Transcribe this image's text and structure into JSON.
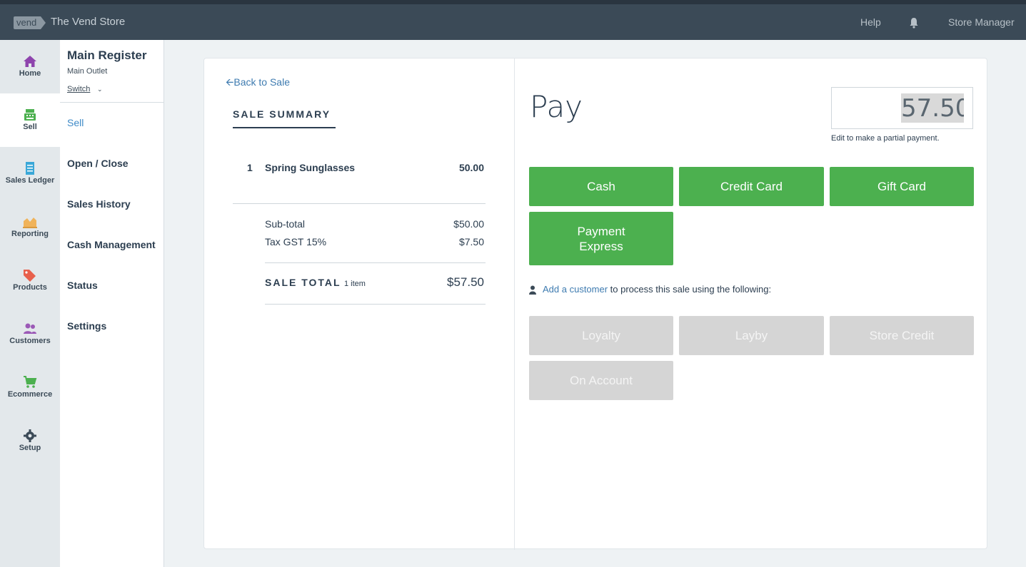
{
  "topbar": {
    "logo": "vend",
    "store_name": "The Vend Store",
    "help": "Help",
    "bell_icon": "bell-icon",
    "user": "Store Manager"
  },
  "nav": {
    "items": [
      {
        "label": "Home",
        "icon": "home-icon",
        "color": "#8e44ad"
      },
      {
        "label": "Sell",
        "icon": "register-icon",
        "color": "#4cb04f",
        "active": true
      },
      {
        "label": "Sales Ledger",
        "icon": "ledger-icon",
        "color": "#3ba8d8"
      },
      {
        "label": "Reporting",
        "icon": "chart-icon",
        "color": "#f0b35a"
      },
      {
        "label": "Products",
        "icon": "tags-icon",
        "color": "#e8604c"
      },
      {
        "label": "Customers",
        "icon": "users-icon",
        "color": "#9b59b6"
      },
      {
        "label": "Ecommerce",
        "icon": "cart-icon",
        "color": "#4cb04f"
      },
      {
        "label": "Setup",
        "icon": "gear-icon",
        "color": "#3b4a57"
      }
    ]
  },
  "register": {
    "title": "Main Register",
    "outlet": "Main Outlet",
    "switch": "Switch",
    "menu": [
      "Sell",
      "Open / Close",
      "Sales History",
      "Cash Management",
      "Status",
      "Settings"
    ]
  },
  "sale": {
    "back": "Back to Sale",
    "summary_title": "SALE SUMMARY",
    "line_item": {
      "qty": "1",
      "name": "Spring Sunglasses",
      "price": "50.00"
    },
    "subtotal_label": "Sub-total",
    "subtotal_value": "$50.00",
    "tax_label": "Tax GST 15%",
    "tax_value": "$7.50",
    "total_label": "SALE TOTAL",
    "total_items": "1 item",
    "total_value": "$57.50"
  },
  "pay": {
    "title": "Pay",
    "amount": "57.50",
    "hint": "Edit to make a partial payment.",
    "methods": [
      "Cash",
      "Credit Card",
      "Gift Card"
    ],
    "method4": [
      "Payment",
      "Express"
    ],
    "customer_link": "Add a customer",
    "customer_text": " to process this sale using the following:",
    "customer_methods": [
      "Loyalty",
      "Layby",
      "Store Credit",
      "On Account"
    ]
  }
}
